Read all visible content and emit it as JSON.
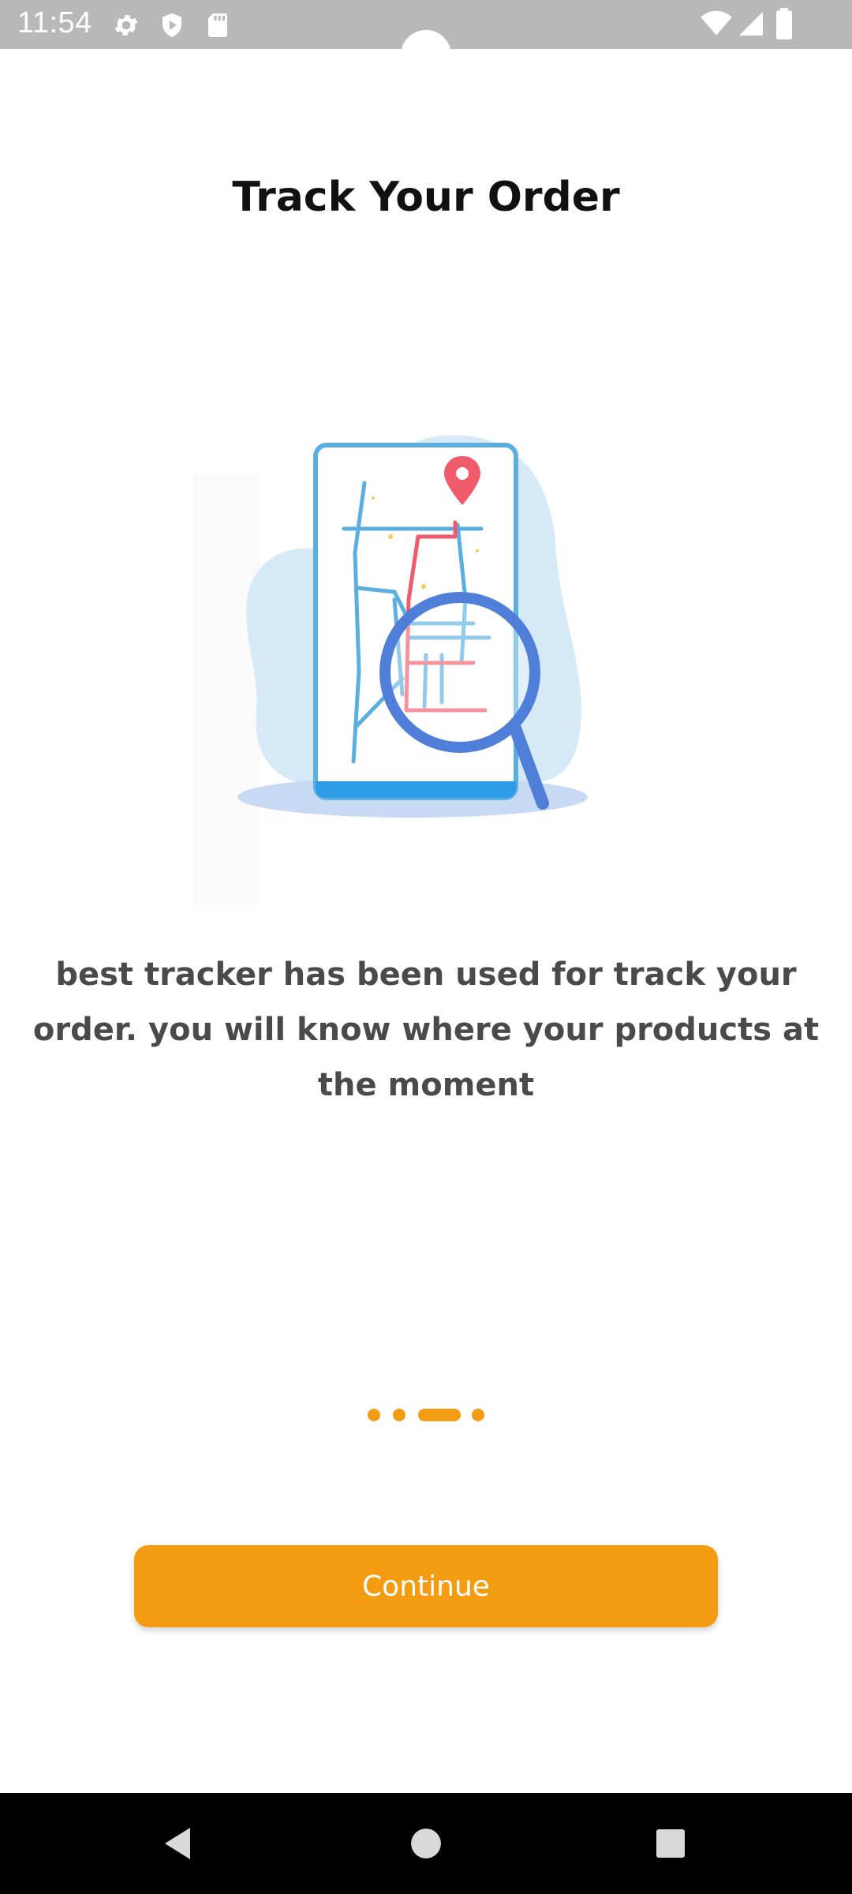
{
  "status_bar": {
    "time": "11:54",
    "left_icons": [
      "gear-icon",
      "shield-play-icon",
      "sd-card-icon"
    ],
    "right_icons": [
      "wifi-icon",
      "signal-icon",
      "battery-icon"
    ]
  },
  "page": {
    "title": "Track Your Order",
    "description": "best tracker has been used for track your order. you will know where your products at the moment",
    "illustration": "phone-map-tracking-illustration"
  },
  "pagination": {
    "total": 4,
    "active_index": 2
  },
  "continue_label": "Continue",
  "colors": {
    "accent": "#f39c12",
    "title": "#111111",
    "description": "#4a4a4a",
    "status_bar": "#b8b8b8",
    "nav_bar": "#000000"
  },
  "nav": {
    "icons": [
      "back-icon",
      "home-icon",
      "recents-icon"
    ]
  }
}
